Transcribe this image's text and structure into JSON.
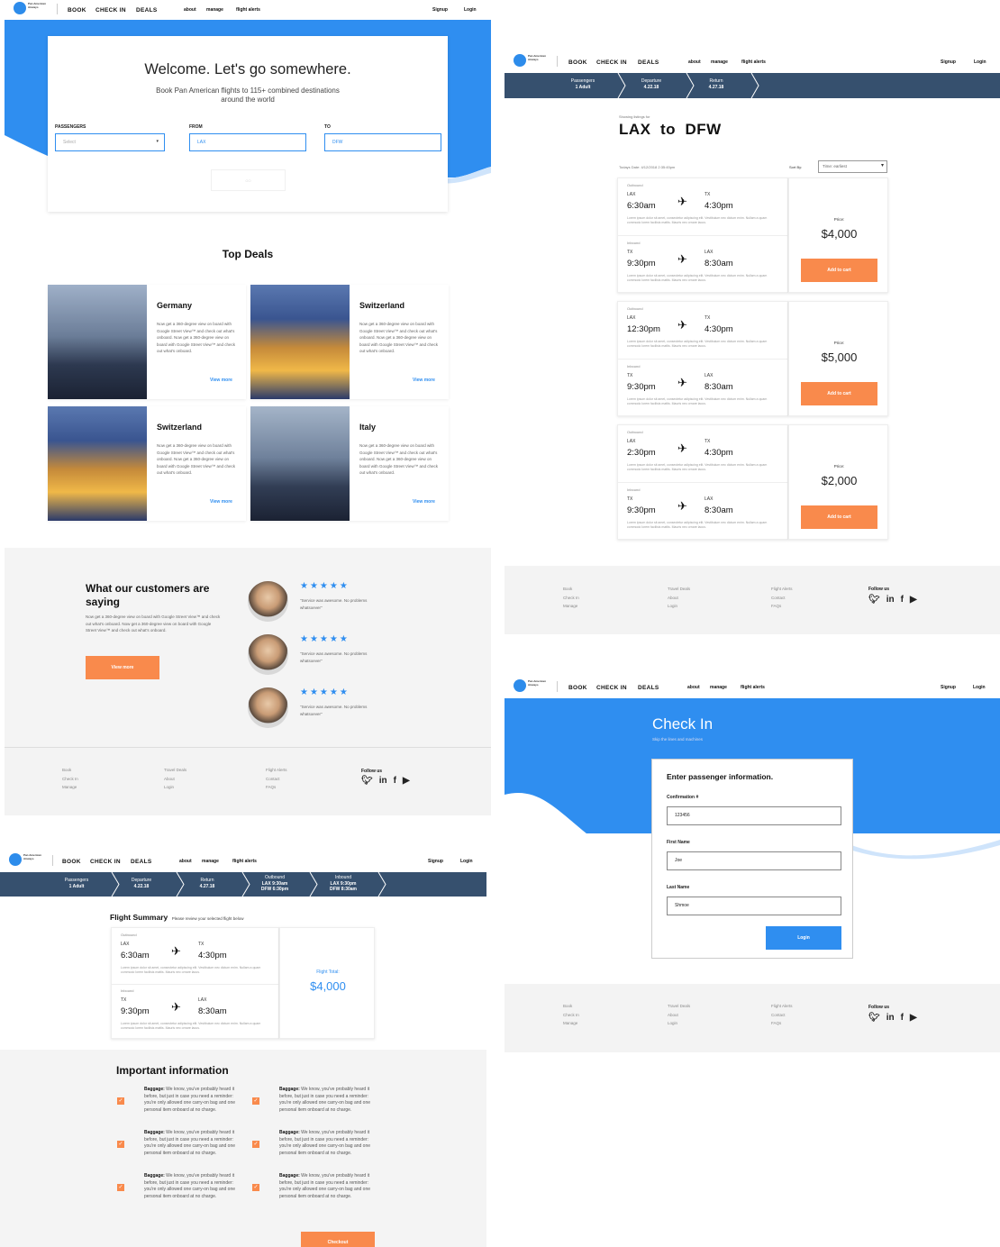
{
  "nav": {
    "brand": "Pan American Airways",
    "book": "BOOK",
    "checkin": "CHECK IN",
    "deals": "DEALS",
    "about": "about",
    "manage": "manage",
    "alerts": "flight alerts",
    "signup": "Signup",
    "login": "Login"
  },
  "home": {
    "title": "Welcome. Let's go somewhere.",
    "subtitle": "Book Pan American flights to 115+ combined destinations around the world",
    "passengers_label": "PASSENGERS",
    "passengers_placeholder": "Select",
    "from_label": "FROM",
    "from_value": "LAX",
    "to_label": "TO",
    "to_value": "DFW",
    "search_btn": "GO",
    "top_deals": "Top Deals",
    "deals": [
      {
        "name": "Germany",
        "desc": "Now get a 360-degree view on board with Google Street View™ and check out what's onboard. Now get a 360-degree view on board with Google Street View™ and check out what's onboard.",
        "link": "View more"
      },
      {
        "name": "Switzerland",
        "desc": "Now get a 360-degree view on board with Google Street View™ and check out what's onboard. Now get a 360-degree view on board with Google Street View™ and check out what's onboard.",
        "link": "View more"
      },
      {
        "name": "Switzerland",
        "desc": "Now get a 360-degree view on board with Google Street View™ and check out what's onboard. Now get a 360-degree view on board with Google Street View™ and check out what's onboard.",
        "link": "View more"
      },
      {
        "name": "Italy",
        "desc": "Now get a 360-degree view on board with Google Street View™ and check out what's onboard. Now get a 360-degree view on board with Google Street View™ and check out what's onboard.",
        "link": "View more"
      }
    ],
    "testimonials_title": "What our customers are saying",
    "testimonials_desc": "Now get a 360-degree view on board with Google Street View™ and check out what's onboard. Now get a 360-degree view on board with Google Street View™ and check out what's onboard.",
    "testimonials_btn": "View more",
    "reviews": [
      {
        "stars": "★★★★★",
        "text": "\"Service was awesome. No problems whatsoever\""
      },
      {
        "stars": "★★★★★",
        "text": "\"Service was awesome. No problems whatsoever\""
      },
      {
        "stars": "★★★★★",
        "text": "\"Service was awesome. No problems whatsoever\""
      }
    ]
  },
  "footer": {
    "c1": [
      "Book",
      "Check In",
      "Manage"
    ],
    "c2": [
      "Travel Deals",
      "About",
      "Login"
    ],
    "c3": [
      "Flight Alerts",
      "Contact",
      "FAQs"
    ],
    "follow": "Follow us",
    "social": [
      "twitter-icon",
      "linkedin-icon",
      "facebook-icon",
      "youtube-icon"
    ]
  },
  "listing": {
    "steps": [
      {
        "a": "Passengers",
        "b": "1 Adult"
      },
      {
        "a": "Departure",
        "b": "4.22.18"
      },
      {
        "a": "Return",
        "b": "4.27.18"
      }
    ],
    "showing": "Showing listings for",
    "route": "LAX  to  DFW",
    "date": "Todays Date: 4/12/2018 2:35:45pm",
    "sortby": "Sort By:",
    "sort_value": "Time: earliest",
    "price_label": "Price:",
    "cart_btn": "Add to cart",
    "lorem": "Lorem ipsum dolor sit amet, consectetur adipiscing elit. Vestibulum nec dictum enim. Nullam a quam commodo lorem facilisis mattis. Mauris nec ornare lacus.",
    "flights": [
      {
        "out": {
          "label": "Outbound",
          "from": "LAX",
          "to": "TX",
          "dep": "6:30am",
          "arr": "4:30pm"
        },
        "in": {
          "label": "Inbound",
          "from": "TX",
          "to": "LAX",
          "dep": "9:30pm",
          "arr": "8:30am"
        },
        "price": "$4,000"
      },
      {
        "out": {
          "label": "Outbound",
          "from": "LAX",
          "to": "TX",
          "dep": "12:30pm",
          "arr": "4:30pm"
        },
        "in": {
          "label": "Inbound",
          "from": "TX",
          "to": "LAX",
          "dep": "9:30pm",
          "arr": "8:30am"
        },
        "price": "$5,000"
      },
      {
        "out": {
          "label": "Outbound",
          "from": "LAX",
          "to": "TX",
          "dep": "2:30pm",
          "arr": "4:30pm"
        },
        "in": {
          "label": "Inbound",
          "from": "TX",
          "to": "LAX",
          "dep": "9:30pm",
          "arr": "8:30am"
        },
        "price": "$2,000"
      }
    ]
  },
  "summary": {
    "steps": [
      {
        "a": "Passengers",
        "b": "1 Adult"
      },
      {
        "a": "Departure",
        "b": "4.22.18"
      },
      {
        "a": "Return",
        "b": "4.27.18"
      },
      {
        "a": "Outbound",
        "b": "LAX 9:30am",
        "c": "DFW 6:30pm"
      },
      {
        "a": "Inbound",
        "b": "LAX 9:30pm",
        "c": "DFW 8:30am"
      }
    ],
    "title": "Flight Summary",
    "title_sub": "Please review your selected flight below",
    "total_label": "Flight Total:",
    "total": "$4,000",
    "info_title": "Important information",
    "info_bold": "Baggage:",
    "info_text": "We know, you've probably heard it before, but just in case you need a reminder: you're only allowed one carry-on bag and one personal item onboard at no charge.",
    "checkout": "Checkout"
  },
  "checkin": {
    "title": "Check In",
    "subtitle": "Skip the lines and machines",
    "form_title": "Enter passenger information.",
    "conf_label": "Confirmation #",
    "conf_value": "123456",
    "first_label": "First Name",
    "first_value": "Joe",
    "last_label": "Last Name",
    "last_value": "Shmoe",
    "btn": "Login"
  }
}
